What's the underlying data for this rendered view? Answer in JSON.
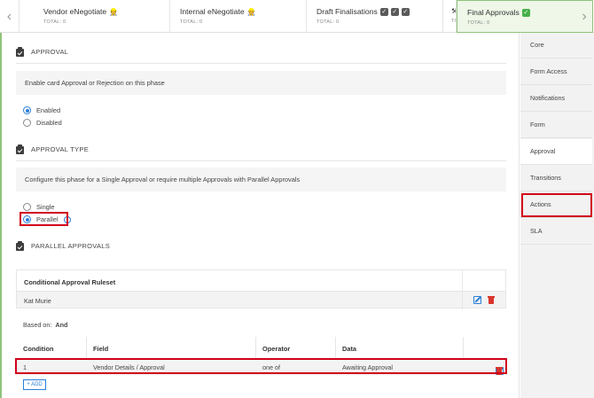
{
  "phases": [
    {
      "name": "Vendor eNegotiate",
      "total": "TOTAL: 0",
      "emoji": "👷"
    },
    {
      "name": "Internal eNegotiate",
      "total": "TOTAL: 0",
      "emoji": "👷"
    },
    {
      "name": "Draft Finalisations",
      "total": "TOTAL: 0",
      "checks": 3
    },
    {
      "name": "",
      "total": "TO",
      "emoji": "⚒"
    },
    {
      "name": "Final Approvals",
      "total": "TOTAL: 0",
      "check": "green"
    }
  ],
  "nav": {
    "left": "‹",
    "right": "›"
  },
  "approval": {
    "title": "APPROVAL",
    "description": "Enable card Approval or Rejection on this phase",
    "options": [
      "Enabled",
      "Disabled"
    ],
    "selected": "Enabled"
  },
  "approval_type": {
    "title": "APPROVAL TYPE",
    "description": "Configure this phase for a Single Approval or require multiple Approvals with Parallel Approvals",
    "options": [
      "Single",
      "Parallel"
    ],
    "selected": "Parallel",
    "info_symbol": "i"
  },
  "parallel": {
    "title": "PARALLEL APPROVALS",
    "ruleset_header": "Conditional Approval Ruleset",
    "ruleset_item": "Kat Murie",
    "based_on_label": "Based on:",
    "based_on_value": "And",
    "columns": [
      "Condition",
      "Field",
      "Operator",
      "Data"
    ],
    "rows": [
      {
        "condition": "1",
        "field": "Vendor Details / Approval",
        "operator": "one of",
        "data": "Awaiting Approval"
      }
    ],
    "add_label": "+ ADD"
  },
  "sidebar": {
    "items": [
      "Core",
      "Form Access",
      "Notifications",
      "Form",
      "Approval",
      "Transitions",
      "Actions",
      "SLA"
    ],
    "active": "Approval",
    "highlighted": "Actions"
  },
  "colors": {
    "accent": "#2b7fd8",
    "highlight": "#d0021b",
    "active_phase": "#eef7e8",
    "delete": "#d9342b"
  }
}
